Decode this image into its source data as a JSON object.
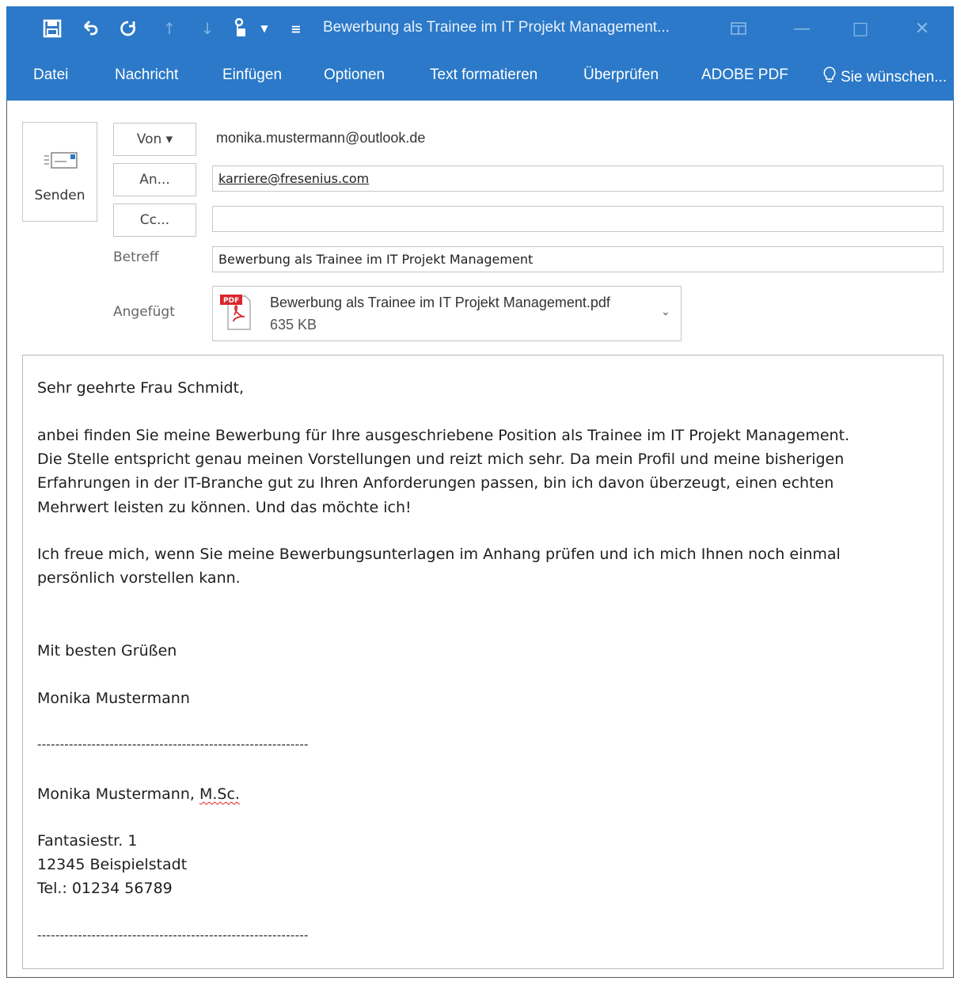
{
  "window": {
    "title": "Bewerbung als Trainee im IT Projekt Management..."
  },
  "colors": {
    "ribbon": "#2b79c8",
    "pdf_red": "#d9262c"
  },
  "qat": {
    "icons": [
      "save-icon",
      "undo-icon",
      "redo-icon",
      "arrow-up-icon",
      "arrow-down-icon",
      "touch-mode-icon",
      "customize-icon"
    ]
  },
  "ribbon": {
    "tabs": [
      "Datei",
      "Nachricht",
      "Einfügen",
      "Optionen",
      "Text formatieren",
      "Überprüfen",
      "ADOBE PDF"
    ],
    "tell_me": "Sie wünschen..."
  },
  "compose": {
    "send_label": "Senden",
    "from_label": "Von ▾",
    "from_value": "monika.mustermann@outlook.de",
    "to_label": "An...",
    "to_value": "karriere@fresenius.com",
    "cc_label": "Cc...",
    "cc_value": "",
    "subject_label": "Betreff",
    "subject_value": "Bewerbung als Trainee im IT Projekt Management",
    "attached_label": "Angefügt",
    "attachment_name": "Bewerbung als Trainee im IT Projekt Management.pdf",
    "attachment_size": "635 KB",
    "attachment_badge": "PDF"
  },
  "body": {
    "salutation": "Sehr geehrte Frau Schmidt,",
    "p1_l1": "anbei finden Sie meine Bewerbung für Ihre ausgeschriebene Position als Trainee im IT Projekt Management.",
    "p1_l2": "Die Stelle entspricht genau meinen Vorstellungen und reizt mich sehr. Da mein Profil und meine bisherigen",
    "p1_l3": "Erfahrungen in der IT-Branche gut zu Ihren Anforderungen passen, bin ich davon überzeugt, einen echten",
    "p1_l4": "Mehrwert leisten zu können. Und das möchte ich!",
    "p2_l1": "Ich freue mich, wenn Sie meine Bewerbungsunterlagen im Anhang prüfen und ich mich Ihnen noch einmal",
    "p2_l2": "persönlich vorstellen kann.",
    "closing": "Mit besten Grüßen",
    "name": "Monika Mustermann",
    "separator": "------------------------------------------------------------",
    "sig_name": "Monika Mustermann,",
    "sig_title": "M.Sc.",
    "street": "Fantasiestr. 1",
    "city": "12345 Beispielstadt",
    "phone": "Tel.: 01234 56789",
    "separator2": "------------------------------------------------------------"
  }
}
